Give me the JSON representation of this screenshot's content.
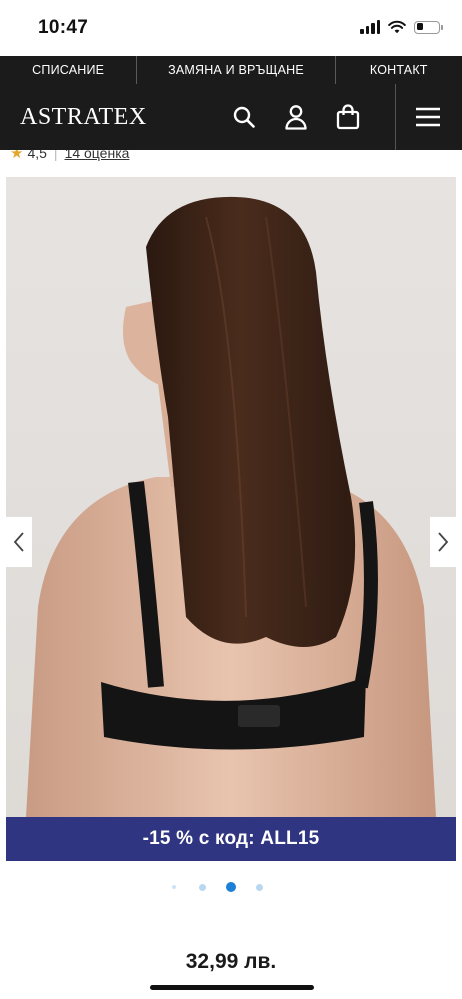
{
  "status_bar": {
    "time": "10:47",
    "battery_level": 0.25
  },
  "top_nav": {
    "links": [
      {
        "label": "СПИСАНИЕ"
      },
      {
        "label": "ЗАМЯНА И ВРЪЩАНЕ"
      },
      {
        "label": "КОНТАКТ"
      }
    ]
  },
  "header": {
    "logo": "ASTRATEX",
    "icons": [
      "search-icon",
      "account-icon",
      "cart-icon",
      "menu-icon"
    ]
  },
  "rating": {
    "score": "4,5",
    "count_label": "14 оценка"
  },
  "gallery": {
    "image_description_icon": "product-photo",
    "slide_count": 4,
    "active_slide": 3
  },
  "promo": {
    "text": "-15 % с код: ALL15"
  },
  "product": {
    "price": "32,99 лв."
  },
  "colors": {
    "header_bg": "#1b1b1b",
    "promo_bg": "#2f3580",
    "dot_active": "#1e7fd6",
    "dot_inactive": "#b8d7f0",
    "star": "#e2a82c"
  }
}
